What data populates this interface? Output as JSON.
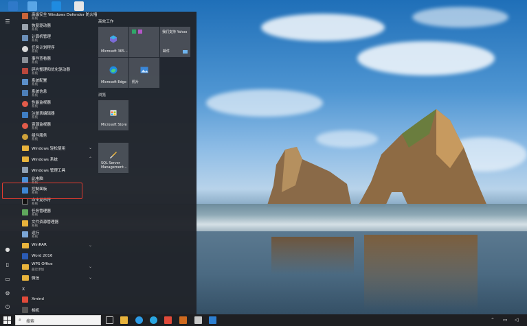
{
  "apps": [
    {
      "id": "defender-firewall",
      "label": "高级安全 Windows Defender 防火墙",
      "sub": "系统"
    },
    {
      "id": "drive-optimizer",
      "label": "恢复驱动器",
      "sub": "系统"
    },
    {
      "id": "computer-management",
      "label": "计算机管理",
      "sub": "系统"
    },
    {
      "id": "task-scheduler",
      "label": "任务计划程序",
      "sub": "系统"
    },
    {
      "id": "event-viewer",
      "label": "事件查看器",
      "sub": "系统"
    },
    {
      "id": "defrag",
      "label": "碎片整理和优化驱动器",
      "sub": "系统"
    },
    {
      "id": "system-config",
      "label": "系统配置",
      "sub": "系统"
    },
    {
      "id": "system-info",
      "label": "系统信息",
      "sub": "系统"
    },
    {
      "id": "perf-monitor",
      "label": "性能监视器",
      "sub": "系统"
    },
    {
      "id": "registry-editor",
      "label": "注册表编辑器",
      "sub": "系统"
    },
    {
      "id": "resource-monitor",
      "label": "资源监视器",
      "sub": "系统"
    },
    {
      "id": "services",
      "label": "组件服务",
      "sub": "系统"
    }
  ],
  "folders": {
    "ease_of_access": "Windows 轻松使用",
    "windows_system": "Windows 系统",
    "winrar": "WinRAR",
    "wps": "WPS Office",
    "wechat": "微信"
  },
  "system_apps": [
    {
      "id": "windows-admin-tools",
      "label": "Windows 管理工具",
      "sub": ""
    },
    {
      "id": "this-pc",
      "label": "此电脑",
      "sub": "系统"
    },
    {
      "id": "control-panel",
      "label": "控制面板",
      "sub": "系统"
    },
    {
      "id": "cmd",
      "label": "命令提示符",
      "sub": "系统"
    },
    {
      "id": "task-manager",
      "label": "任务管理器",
      "sub": "系统"
    },
    {
      "id": "file-explorer",
      "label": "文件资源管理器",
      "sub": "系统"
    },
    {
      "id": "run",
      "label": "运行",
      "sub": "系统"
    }
  ],
  "other_apps": {
    "word": "Word 2016",
    "wps_sub": "最近添加",
    "letter_x": "X",
    "xmind": "Xmind",
    "camera": "相机"
  },
  "tiles": {
    "section_productivity": "高效工作",
    "section_browse": "浏览",
    "m365": "Microsoft 365...",
    "yahoo": "我们支持 Yahoo",
    "mail": "邮件",
    "edge": "Microsoft Edge",
    "photos": "照片",
    "store": "Microsoft Store",
    "sql": "SQL Server Management..."
  },
  "taskbar": {
    "search_placeholder": "搜索"
  },
  "colors": {
    "start_bg": "#21242a",
    "tile_bg": "#4e535c",
    "highlight": "#e43b2f",
    "folder": "#e8b33c"
  }
}
